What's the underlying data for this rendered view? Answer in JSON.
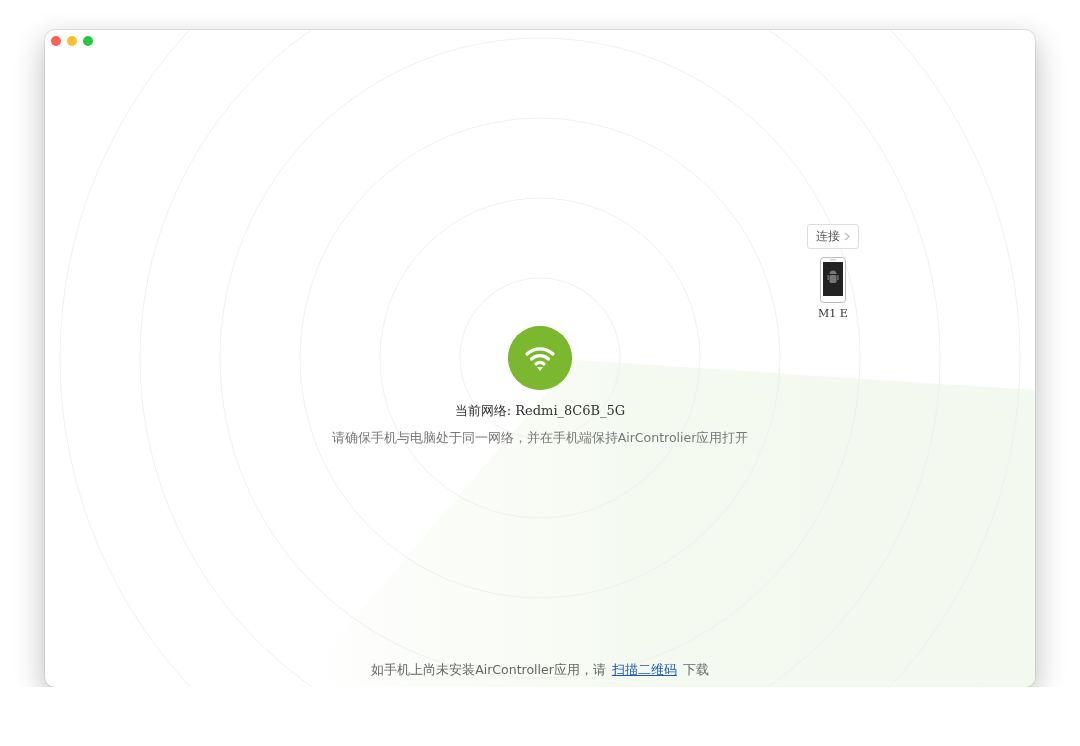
{
  "network": {
    "label": "当前网络: Redmi_8C6B_5G",
    "hint": "请确保手机与电脑处于同一网络，并在手机端保持AirControlier应用打开"
  },
  "devices": [
    {
      "action": "连接",
      "name": "M1 E"
    }
  ],
  "footer": {
    "before": "如手机上尚未安装AirController应用，请",
    "link": "扫描二维码",
    "after": "下载"
  }
}
